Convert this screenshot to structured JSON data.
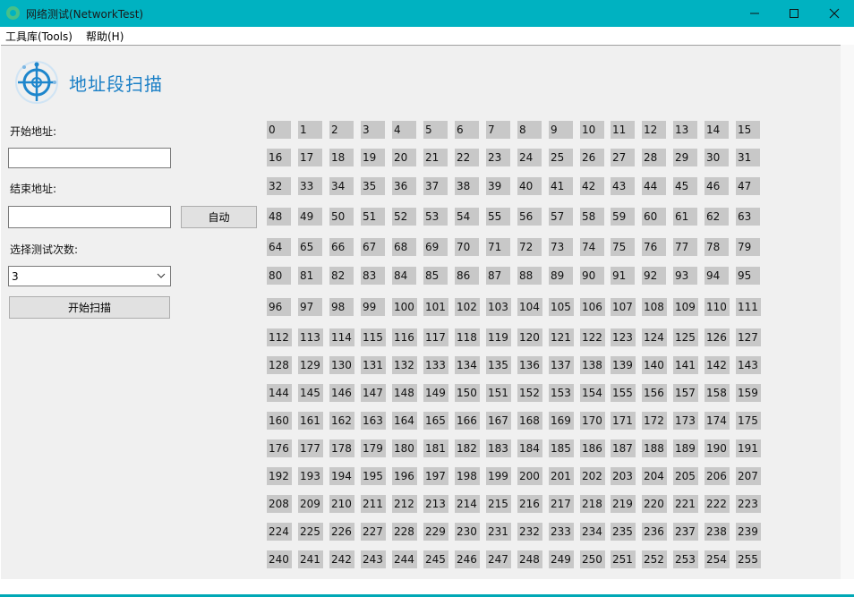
{
  "window": {
    "title": "网络测试(NetworkTest)",
    "controls": {
      "minimize": "—",
      "maximize": "☐",
      "close": "✕"
    },
    "accent_color": "#00b2c1"
  },
  "menu": {
    "items": [
      "工具库(Tools)",
      "帮助(H)"
    ]
  },
  "page": {
    "heading": "地址段扫描",
    "logo_icon": "crosshair-target-icon"
  },
  "form": {
    "start_label": "开始地址:",
    "start_value": "",
    "end_label": "结束地址:",
    "end_value": "",
    "auto_button": "自动",
    "count_label": "选择测试次数:",
    "count_value": "3",
    "scan_button": "开始扫描"
  },
  "grid": {
    "cells": [
      "0",
      "1",
      "2",
      "3",
      "4",
      "5",
      "6",
      "7",
      "8",
      "9",
      "10",
      "11",
      "12",
      "13",
      "14",
      "15",
      "16",
      "17",
      "18",
      "19",
      "20",
      "21",
      "22",
      "23",
      "24",
      "25",
      "26",
      "27",
      "28",
      "29",
      "30",
      "31",
      "32",
      "33",
      "34",
      "35",
      "36",
      "37",
      "38",
      "39",
      "40",
      "41",
      "42",
      "43",
      "44",
      "45",
      "46",
      "47",
      "48",
      "49",
      "50",
      "51",
      "52",
      "53",
      "54",
      "55",
      "56",
      "57",
      "58",
      "59",
      "60",
      "61",
      "62",
      "63",
      "64",
      "65",
      "66",
      "67",
      "68",
      "69",
      "70",
      "71",
      "72",
      "73",
      "74",
      "75",
      "76",
      "77",
      "78",
      "79",
      "80",
      "81",
      "82",
      "83",
      "84",
      "85",
      "86",
      "87",
      "88",
      "89",
      "90",
      "91",
      "92",
      "93",
      "94",
      "95",
      "96",
      "97",
      "98",
      "99",
      "100",
      "101",
      "102",
      "103",
      "104",
      "105",
      "106",
      "107",
      "108",
      "109",
      "110",
      "111",
      "112",
      "113",
      "114",
      "115",
      "116",
      "117",
      "118",
      "119",
      "120",
      "121",
      "122",
      "123",
      "124",
      "125",
      "126",
      "127",
      "128",
      "129",
      "130",
      "131",
      "132",
      "133",
      "134",
      "135",
      "136",
      "137",
      "138",
      "139",
      "140",
      "141",
      "142",
      "143",
      "144",
      "145",
      "146",
      "147",
      "148",
      "149",
      "150",
      "151",
      "152",
      "153",
      "154",
      "155",
      "156",
      "157",
      "158",
      "159",
      "160",
      "161",
      "162",
      "163",
      "164",
      "165",
      "166",
      "167",
      "168",
      "169",
      "170",
      "171",
      "172",
      "173",
      "174",
      "175",
      "176",
      "177",
      "178",
      "179",
      "180",
      "181",
      "182",
      "183",
      "184",
      "185",
      "186",
      "187",
      "188",
      "189",
      "190",
      "191",
      "192",
      "193",
      "194",
      "195",
      "196",
      "197",
      "198",
      "199",
      "200",
      "201",
      "202",
      "203",
      "204",
      "205",
      "206",
      "207",
      "208",
      "209",
      "210",
      "211",
      "212",
      "213",
      "214",
      "215",
      "216",
      "217",
      "218",
      "219",
      "220",
      "221",
      "222",
      "223",
      "224",
      "225",
      "226",
      "227",
      "228",
      "229",
      "230",
      "231",
      "232",
      "233",
      "234",
      "235",
      "236",
      "237",
      "238",
      "239",
      "240",
      "241",
      "242",
      "243",
      "244",
      "245",
      "246",
      "247",
      "248",
      "249",
      "250",
      "251",
      "252",
      "253",
      "254",
      "255"
    ],
    "cell_color": "#c8c8c8"
  }
}
